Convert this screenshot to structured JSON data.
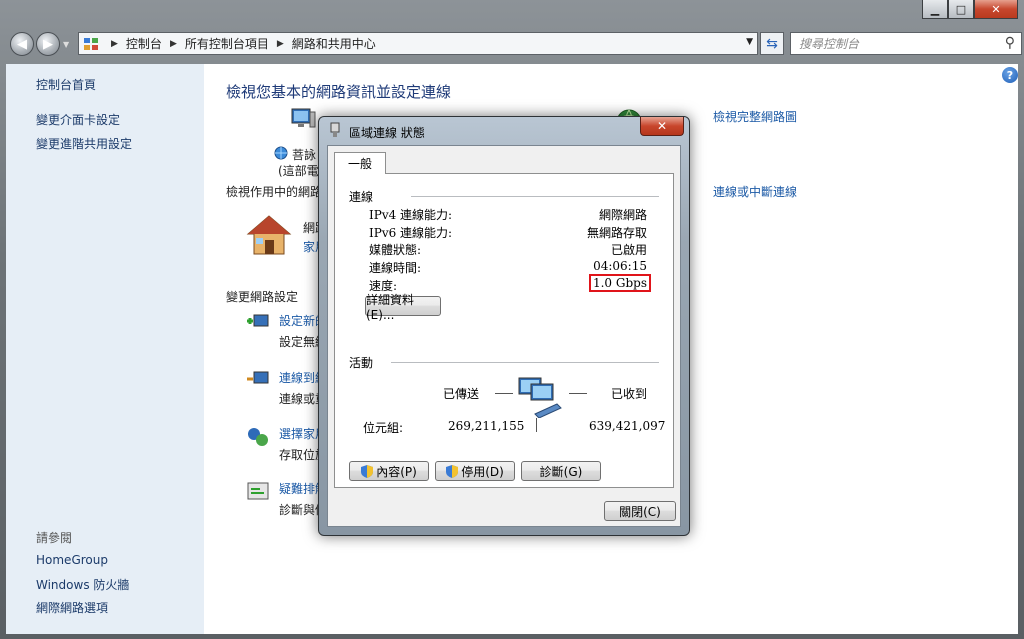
{
  "window": {
    "caption_minimize": "▁",
    "caption_maximize": "□",
    "caption_close": "✕"
  },
  "address_bar": {
    "crumbs": [
      "控制台",
      "所有控制台項目",
      "網路和共用中心"
    ],
    "search_placeholder": "搜尋控制台"
  },
  "sidebar": {
    "home": "控制台首頁",
    "items": [
      "變更介面卡設定",
      "變更進階共用設定"
    ],
    "see_also_title": "請參閱",
    "see_also": [
      "HomeGroup",
      "Windows 防火牆",
      "網際網路選項"
    ]
  },
  "main": {
    "title": "檢視您基本的網路資訊並設定連線",
    "view_full_map": "檢視完整網路圖",
    "computer_name_1": "菩詠",
    "computer_name_2": "(這部電",
    "active_networks_heading": "檢視作用中的網路",
    "connect_disconnect": "連線或中斷連線",
    "network_name": "網路",
    "network_type": "家用",
    "change_settings_heading": "變更網路設定",
    "tasks": [
      {
        "link": "設定新的",
        "desc": "設定無線"
      },
      {
        "link": "連線到網",
        "desc": "連線或重"
      },
      {
        "link": "選擇家用",
        "desc": "存取位於"
      },
      {
        "link": "疑難排解",
        "desc": "診斷與修"
      }
    ]
  },
  "dialog": {
    "title": "區域連線 狀態",
    "close_label": "✕",
    "tab_general": "一般",
    "connection_group": "連線",
    "rows": [
      {
        "label": "IPv4 連線能力:",
        "value": "網際網路"
      },
      {
        "label": "IPv6 連線能力:",
        "value": "無網路存取"
      },
      {
        "label": "媒體狀態:",
        "value": "已啟用"
      },
      {
        "label": "連線時間:",
        "value": "04:06:15"
      },
      {
        "label": "速度:",
        "value": "1.0 Gbps"
      }
    ],
    "details_button": "詳細資料(E)...",
    "activity_group": "活動",
    "sent_label": "已傳送",
    "received_label": "已收到",
    "bytes_label": "位元組:",
    "bytes_sent": "269,211,155",
    "bytes_received": "639,421,097",
    "properties_button": "內容(P)",
    "disable_button": "停用(D)",
    "diagnose_button": "診斷(G)",
    "close_button": "關閉(C)"
  }
}
